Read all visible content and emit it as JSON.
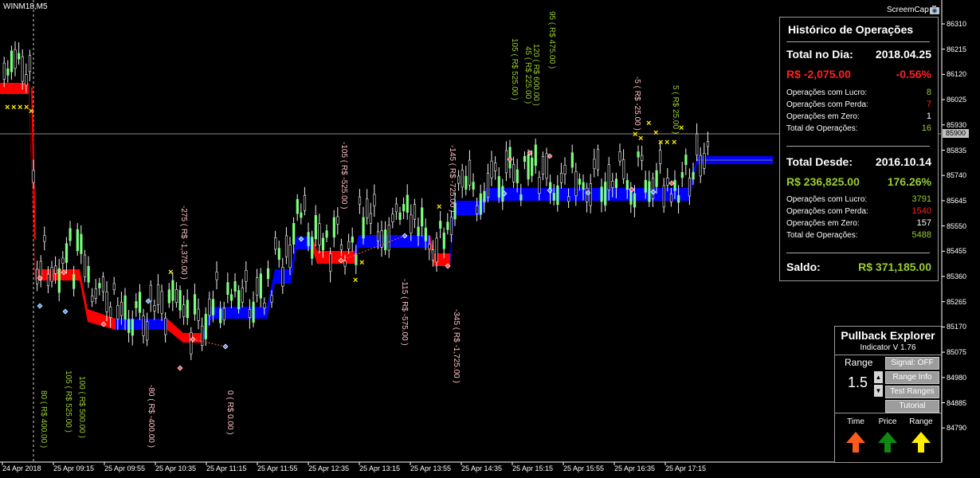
{
  "symbol": "WINM18,M5",
  "screencap_label": "ScreemCap",
  "history": {
    "title": "Histórico de Operações",
    "day_label": "Total no Dia:",
    "day_date": "2018.04.25",
    "day_result": "R$ -2,075.00",
    "day_pct": "-0.56%",
    "day_rows": [
      {
        "label": "Operações com Lucro:",
        "value": "8",
        "color": "#9acd32"
      },
      {
        "label": "Operações com Perda:",
        "value": "7",
        "color": "#ff2020"
      },
      {
        "label": "Operações em Zero:",
        "value": "1",
        "color": "#ffffff"
      },
      {
        "label": "Total de Operações:",
        "value": "16",
        "color": "#9acd32"
      }
    ],
    "since_label": "Total Desde:",
    "since_date": "2016.10.14",
    "since_result": "R$ 236,825.00",
    "since_pct": "176.26%",
    "since_rows": [
      {
        "label": "Operações com Lucro:",
        "value": "3791",
        "color": "#9acd32"
      },
      {
        "label": "Operações com Perda:",
        "value": "1540",
        "color": "#ff2020"
      },
      {
        "label": "Operações em Zero:",
        "value": "157",
        "color": "#ffffff"
      },
      {
        "label": "Total de Operações:",
        "value": "5488",
        "color": "#9acd32"
      }
    ],
    "saldo_label": "Saldo:",
    "saldo_value": "R$ 371,185.00"
  },
  "pullback": {
    "title": "Pullback Explorer",
    "subtitle": "Indicator V 1.76",
    "range_label": "Range",
    "range_value": "1.5",
    "buttons": [
      "Signal: OFF",
      "Range Info",
      "Test Ranges",
      "Tutorial"
    ],
    "arrow_labels": [
      "Time",
      "Price",
      "Range"
    ],
    "arrow_colors": [
      "#ff5a1e",
      "#118811",
      "#ffee00"
    ]
  },
  "price_scale": [
    "86310",
    "86215",
    "86120",
    "86025",
    "85930",
    "85835",
    "85740",
    "85645",
    "85550",
    "85455",
    "85360",
    "85265",
    "85170",
    "85075",
    "84980",
    "84885",
    "84790"
  ],
  "current_price": "85900",
  "time_axis": [
    "24 Apr 2018",
    "25 Apr 09:15",
    "25 Apr 09:55",
    "25 Apr 10:35",
    "25 Apr 11:15",
    "25 Apr 11:55",
    "25 Apr 12:35",
    "25 Apr 13:15",
    "25 Apr 13:55",
    "25 Apr 14:35",
    "25 Apr 15:15",
    "25 Apr 15:55",
    "25 Apr 16:35",
    "25 Apr 17:15"
  ],
  "trade_labels": [
    {
      "text": "80 ( R$ 400.00 )",
      "color": "#9acd32"
    },
    {
      "text": "105 ( R$ 525.00 )",
      "color": "#9acd32"
    },
    {
      "text": "100 ( R$ 500.00 )",
      "color": "#9acd32"
    },
    {
      "text": "-80 ( R$ -400.00 )",
      "color": "#ffc0c8"
    },
    {
      "text": "-275 ( R$ -1,375.00 )",
      "color": "#ffc0c8"
    },
    {
      "text": "0 ( R$ 0.00 )",
      "color": "#ffc0c8"
    },
    {
      "text": "-105 ( R$ -525.00 )",
      "color": "#ffc0c8"
    },
    {
      "text": "-115 ( R$ -575.00 )",
      "color": "#ffc0c8"
    },
    {
      "text": "-145 ( R$ -725.00 )",
      "color": "#ffc0c8"
    },
    {
      "text": "-345 ( R$ -1,725.00 )",
      "color": "#ffc0c8"
    },
    {
      "text": "105 ( R$ 525.00 )",
      "color": "#9acd32"
    },
    {
      "text": "45 ( R$ 225.00 )",
      "color": "#9acd32"
    },
    {
      "text": "120 ( R$ 600.00 )",
      "color": "#9acd32"
    },
    {
      "text": "95 ( R$ 475.00 )",
      "color": "#9acd32"
    },
    {
      "text": "-5 ( R$ -25.00 )",
      "color": "#ffc0c8"
    },
    {
      "text": "5 ( R$ 25.00 )",
      "color": "#9acd32"
    }
  ]
}
